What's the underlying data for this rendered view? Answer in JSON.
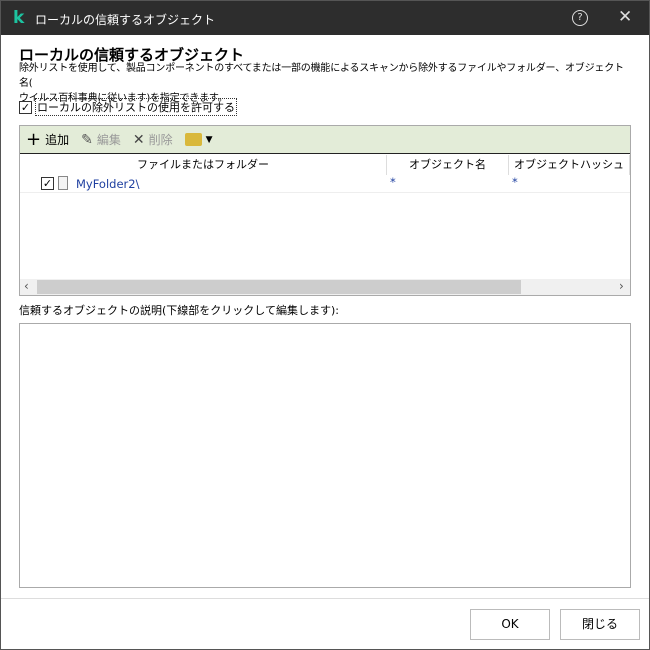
{
  "window": {
    "title": "ローカルの信頼するオブジェクト",
    "help_icon": "?",
    "close_icon": "✕"
  },
  "heading": "ローカルの信頼するオブジェクト",
  "description": [
    "除外リストを使用して、製品コンポーネントのすべてまたは一部の機能によるスキャンから除外するファイルやフォルダー、オブジェクト名(",
    "ウイルス百科事典に従います)を指定できます。"
  ],
  "allow_checkbox": {
    "label": "ローカルの除外リストの使用を許可する",
    "checked": true
  },
  "toolbar": {
    "add": "追加",
    "edit": "編集",
    "delete": "削除"
  },
  "table": {
    "columns": [
      "ファイルまたはフォルダー",
      "オブジェクト名",
      "オブジェクトハッシュ"
    ],
    "rows": [
      {
        "checked": true,
        "path": "MyFolder2\\",
        "object_name": "*",
        "object_hash": "*"
      }
    ]
  },
  "description_label": "信頼するオブジェクトの説明(下線部をクリックして編集します):",
  "buttons": {
    "ok": "OK",
    "close": "閉じる"
  }
}
